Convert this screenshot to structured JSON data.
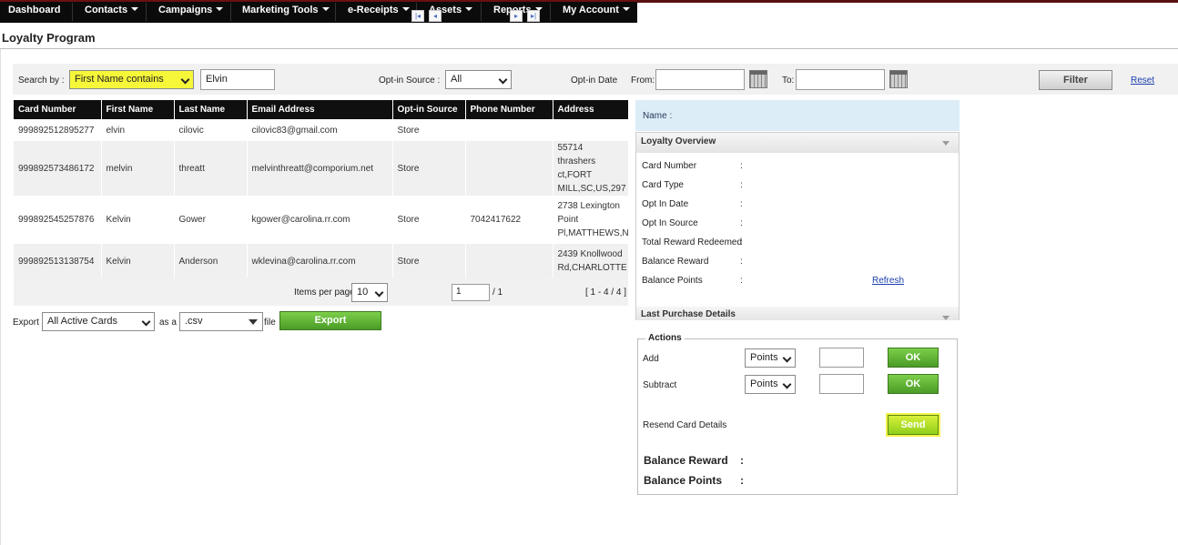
{
  "nav": [
    "Dashboard",
    "Contacts",
    "Campaigns",
    "Marketing Tools",
    "e-Receipts",
    "Assets",
    "Reports",
    "My Account"
  ],
  "page_title": "Loyalty Program",
  "filter": {
    "search_by_label": "Search by :",
    "search_by_value": "First Name contains",
    "search_text": "Elvin",
    "optin_source_label": "Opt-in Source :",
    "optin_source_value": "All",
    "optin_date_label": "Opt-in Date",
    "from_label": "From:",
    "to_label": "To:",
    "filter_button": "Filter",
    "reset_link": "Reset"
  },
  "table": {
    "headers": [
      "Card Number",
      "First Name",
      "Last Name",
      "Email Address",
      "Opt-in Source",
      "Phone Number",
      "Address"
    ],
    "rows": [
      [
        "999892512895277",
        "elvin",
        "cilovic",
        "cilovic83@gmail.com",
        "Store",
        "",
        ""
      ],
      [
        "999892573486172",
        "melvin",
        "threatt",
        "melvinthreatt@comporium.net",
        "Store",
        "",
        "55714 thrashers ct,FORT MILL,SC,US,297"
      ],
      [
        "999892545257876",
        "Kelvin",
        "Gower",
        "kgower@carolina.rr.com",
        "Store",
        "7042417622",
        "2738 Lexington Point Pl,MATTHEWS,N"
      ],
      [
        "999892513138754",
        "Kelvin",
        "Anderson",
        "wklevina@carolina.rr.com",
        "Store",
        "",
        "2439 Knollwood Rd,CHARLOTTE"
      ]
    ]
  },
  "pager": {
    "items_per_page_label": "Items per page:",
    "items_per_page": "10",
    "page_input": "1",
    "page_total": "/ 1",
    "range": "[ 1 - 4 / 4 ]"
  },
  "export": {
    "label": "Export",
    "cards_value": "All Active Cards",
    "as_label": "as a",
    "format_value": ".csv",
    "file_label": "file",
    "button": "Export"
  },
  "details": {
    "name_label": "Name :",
    "overview_title": "Loyalty Overview",
    "fields": [
      "Card Number",
      "Card Type",
      "Opt In Date",
      "Opt In Source",
      "Total Reward Redeemed",
      "Balance Reward",
      "Balance Points"
    ],
    "colon": ":",
    "refresh_link": "Refresh",
    "last_purchase_title": "Last Purchase Details"
  },
  "actions": {
    "legend": "Actions",
    "add_label": "Add",
    "subtract_label": "Subtract",
    "add_unit": "Points",
    "subtract_unit": "Points",
    "ok_label": "OK",
    "resend_label": "Resend Card Details",
    "send_button": "Send",
    "balance_reward_label": "Balance Reward",
    "balance_points_label": "Balance Points",
    "colon": ":"
  },
  "colors": {
    "nav_bg": "#0b0b0b",
    "highlight": "#f7f73a",
    "green_button": "#5aab2e",
    "name_bar": "#dcedf8",
    "link": "#1a3fb0"
  }
}
